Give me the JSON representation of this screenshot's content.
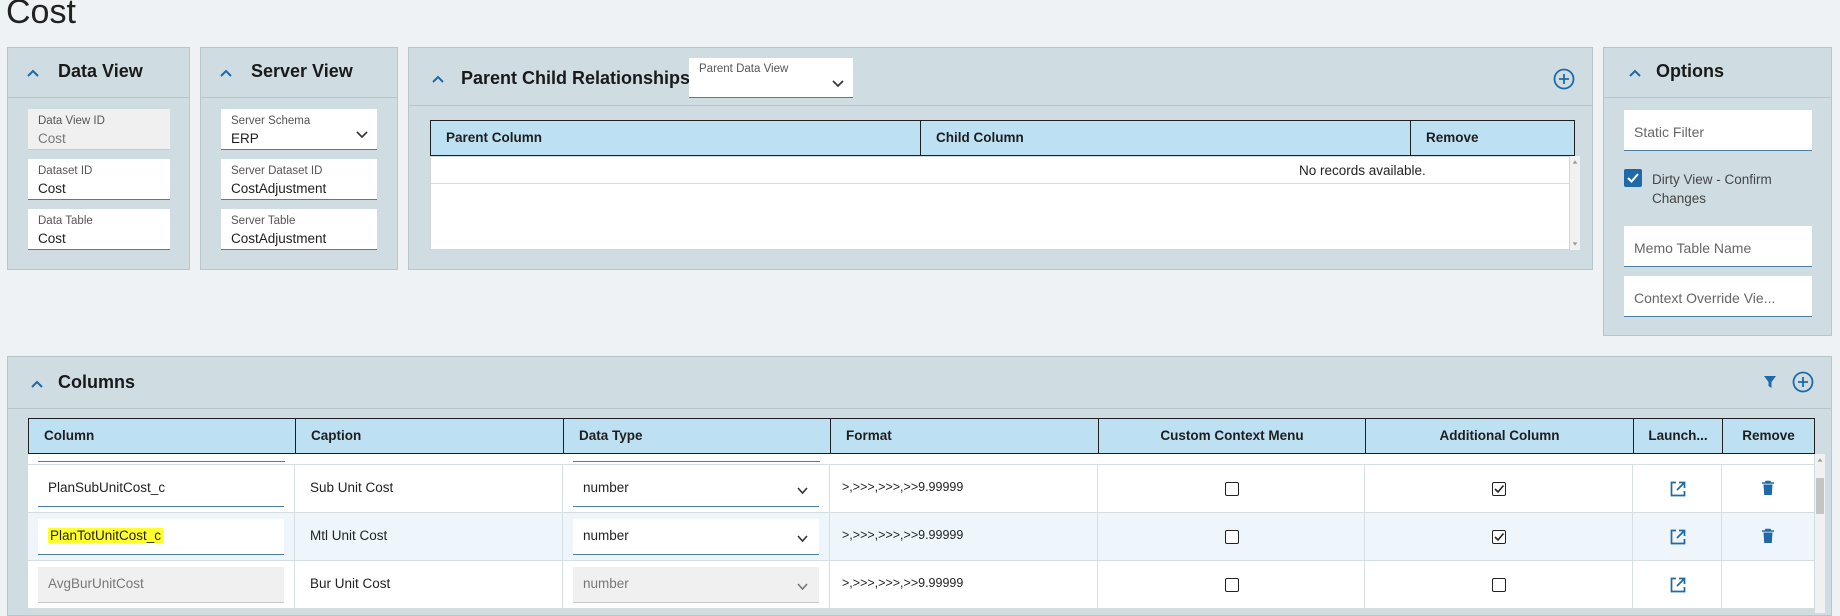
{
  "page": {
    "title": "Cost"
  },
  "data_view": {
    "title": "Data View",
    "fields": [
      {
        "label": "Data View ID",
        "value": "Cost",
        "disabled": true
      },
      {
        "label": "Dataset ID",
        "value": "Cost"
      },
      {
        "label": "Data Table",
        "value": "Cost"
      }
    ]
  },
  "server_view": {
    "title": "Server View",
    "fields": [
      {
        "label": "Server Schema",
        "value": "ERP",
        "dropdown": true
      },
      {
        "label": "Server Dataset ID",
        "value": "CostAdjustment"
      },
      {
        "label": "Server Table",
        "value": "CostAdjustment"
      }
    ]
  },
  "relationships": {
    "title": "Parent Child Relationships",
    "parent_data_view_label": "Parent Data View",
    "columns": [
      "Parent Column",
      "Child Column",
      "Remove"
    ],
    "empty_text": "No records available."
  },
  "options": {
    "title": "Options",
    "static_filter_placeholder": "Static Filter",
    "dirty_view_label_line1": "Dirty View - Confirm",
    "dirty_view_label_line2": "Changes",
    "dirty_view_checked": true,
    "memo_table_placeholder": "Memo Table Name",
    "context_override_placeholder": "Context Override Vie..."
  },
  "columns_panel": {
    "title": "Columns",
    "headers": [
      "Column",
      "Caption",
      "Data Type",
      "Format",
      "Custom Context Menu",
      "Additional Column",
      "Launch...",
      "Remove"
    ],
    "rows": [
      {
        "column": "PlanSubUnitCost_c",
        "caption": "Sub Unit Cost",
        "data_type": "number",
        "format": ">,>>>,>>>,>>9.99999",
        "custom_context_menu": false,
        "additional_column": true,
        "removable": true,
        "disabled": false,
        "highlighted": false
      },
      {
        "column": "PlanTotUnitCost_c",
        "caption": "Mtl Unit Cost",
        "data_type": "number",
        "format": ">,>>>,>>>,>>9.99999",
        "custom_context_menu": false,
        "additional_column": true,
        "removable": true,
        "disabled": false,
        "highlighted": true
      },
      {
        "column": "AvgBurUnitCost",
        "caption": "Bur Unit Cost",
        "data_type": "number",
        "format": ">,>>>,>>>,>>9.99999",
        "custom_context_menu": false,
        "additional_column": false,
        "removable": false,
        "disabled": true,
        "highlighted": false
      }
    ]
  },
  "colors": {
    "accent": "#1e6aa8",
    "header_bg": "#bee0f3",
    "panel_bg": "#cfdde3",
    "highlight": "#ffff2d"
  }
}
